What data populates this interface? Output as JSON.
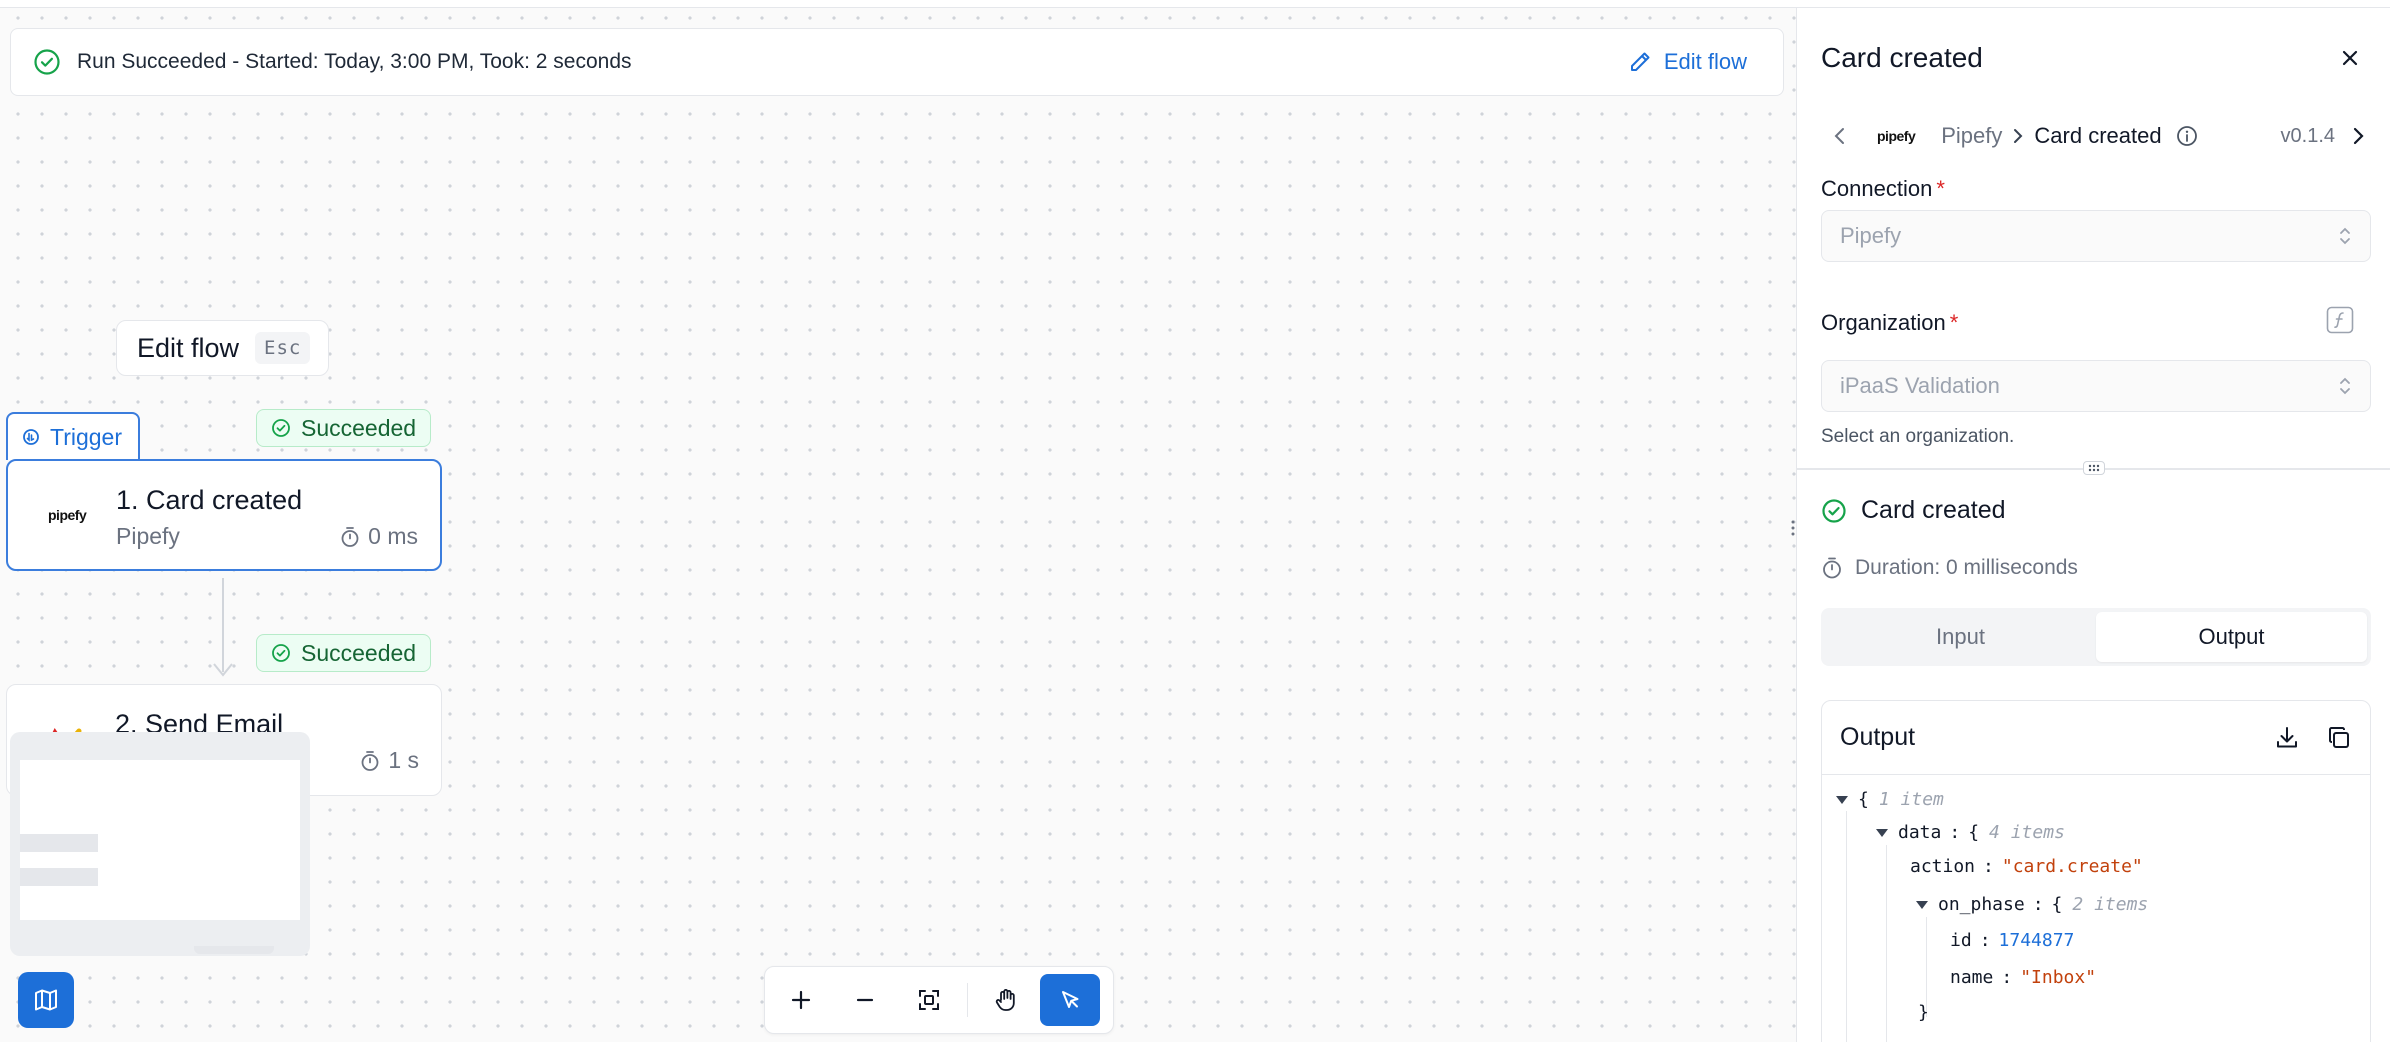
{
  "run_banner": {
    "status_text": "Run Succeeded - Started: Today, 3:00 PM, Took: 2 seconds",
    "edit_flow_label": "Edit flow"
  },
  "canvas": {
    "edit_flow_label": "Edit flow",
    "esc_key": "Esc",
    "trigger_label": "Trigger",
    "steps": [
      {
        "status": "Succeeded",
        "title": "1. Card created",
        "app": "Pipefy",
        "logo_text": "pipefy",
        "duration": "0 ms"
      },
      {
        "status": "Succeeded",
        "title": "2. Send Email",
        "app": "",
        "duration": "1 s"
      }
    ]
  },
  "toolbar": {
    "tools": [
      "zoom-in",
      "zoom-out",
      "fit-view",
      "pan",
      "select"
    ]
  },
  "panel": {
    "title": "Card created",
    "breadcrumb": {
      "logo_text": "pipefy",
      "app": "Pipefy",
      "separator": ">",
      "trigger": "Card created",
      "version": "v0.1.4"
    },
    "connection": {
      "label": "Connection",
      "required_mark": "*",
      "value": "Pipefy"
    },
    "organization": {
      "label": "Organization",
      "required_mark": "*",
      "placeholder": "iPaaS Validation",
      "helper": "Select an organization."
    },
    "result": {
      "title": "Card created",
      "duration": "Duration: 0 milliseconds"
    },
    "tabs": [
      {
        "label": "Input",
        "active": false
      },
      {
        "label": "Output",
        "active": true
      }
    ],
    "output": {
      "title": "Output",
      "json": {
        "root_open": "{",
        "root_meta": "1 item",
        "data_key": "data",
        "data_open": "{",
        "data_meta": "4 items",
        "action_key": "action",
        "action_value": "\"card.create\"",
        "on_phase_key": "on_phase",
        "on_phase_open": "{",
        "on_phase_meta": "2 items",
        "id_key": "id",
        "id_value": "1744877",
        "name_key": "name",
        "name_value": "\"Inbox\"",
        "close": "}",
        "colon": ":"
      }
    }
  },
  "colors": {
    "accent": "#1d6fd8",
    "success": "#16a34a",
    "string": "#c2410c",
    "number": "#1d6fd8"
  }
}
